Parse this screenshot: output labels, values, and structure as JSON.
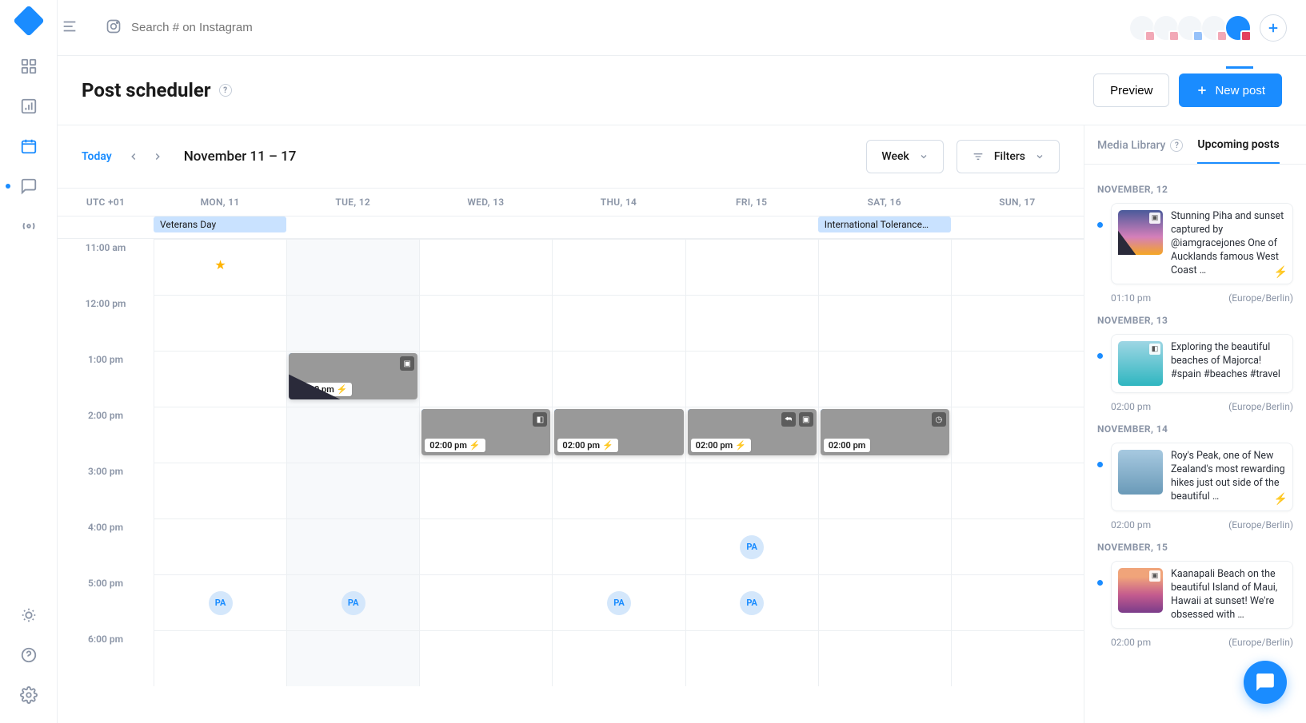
{
  "search": {
    "placeholder": "Search # on Instagram"
  },
  "page": {
    "title": "Post scheduler",
    "preview_btn": "Preview",
    "new_post_btn": "New post"
  },
  "cal_toolbar": {
    "today": "Today",
    "range": "November 11 – 17",
    "view": "Week",
    "filters": "Filters"
  },
  "cal_header": {
    "tz": "UTC +01",
    "days": [
      "MON, 11",
      "TUE, 12",
      "WED, 13",
      "THU, 14",
      "FRI, 15",
      "SAT, 16",
      "SUN, 17"
    ]
  },
  "allday": {
    "veterans": "Veterans Day",
    "tolerance": "International Tolerance…"
  },
  "hours": [
    "11:00 am",
    "12:00 pm",
    "1:00 pm",
    "2:00 pm",
    "3:00 pm",
    "4:00 pm",
    "5:00 pm",
    "6:00 pm"
  ],
  "events": {
    "tue_1": {
      "time": "01:10 pm"
    },
    "wed_2": {
      "time": "02:00 pm"
    },
    "thu_2": {
      "time": "02:00 pm"
    },
    "fri_2": {
      "time": "02:00 pm"
    },
    "sat_2": {
      "time": "02:00 pm"
    }
  },
  "avatar_label": "PA",
  "panel": {
    "tab_media": "Media Library",
    "tab_upcoming": "Upcoming posts",
    "groups": {
      "g1": {
        "label": "NOVEMBER, 12",
        "text": "Stunning Piha and sunset captured by @iamgracejones One of Aucklands famous West Coast …",
        "time": "01:10 pm",
        "tz": "(Europe/Berlin)"
      },
      "g2": {
        "label": "NOVEMBER, 13",
        "text": "Exploring the beautiful beaches of Majorca! #spain #beaches #travel",
        "time": "02:00 pm",
        "tz": "(Europe/Berlin)"
      },
      "g3": {
        "label": "NOVEMBER, 14",
        "text": "Roy's Peak, one of New Zealand's most rewarding hikes just out side of the beautiful …",
        "time": "02:00 pm",
        "tz": "(Europe/Berlin)"
      },
      "g4": {
        "label": "NOVEMBER, 15",
        "text": "Kaanapali Beach on the beautiful Island of Maui, Hawaii at sunset! We're obsessed with …",
        "time": "02:00 pm",
        "tz": "(Europe/Berlin)"
      }
    }
  }
}
